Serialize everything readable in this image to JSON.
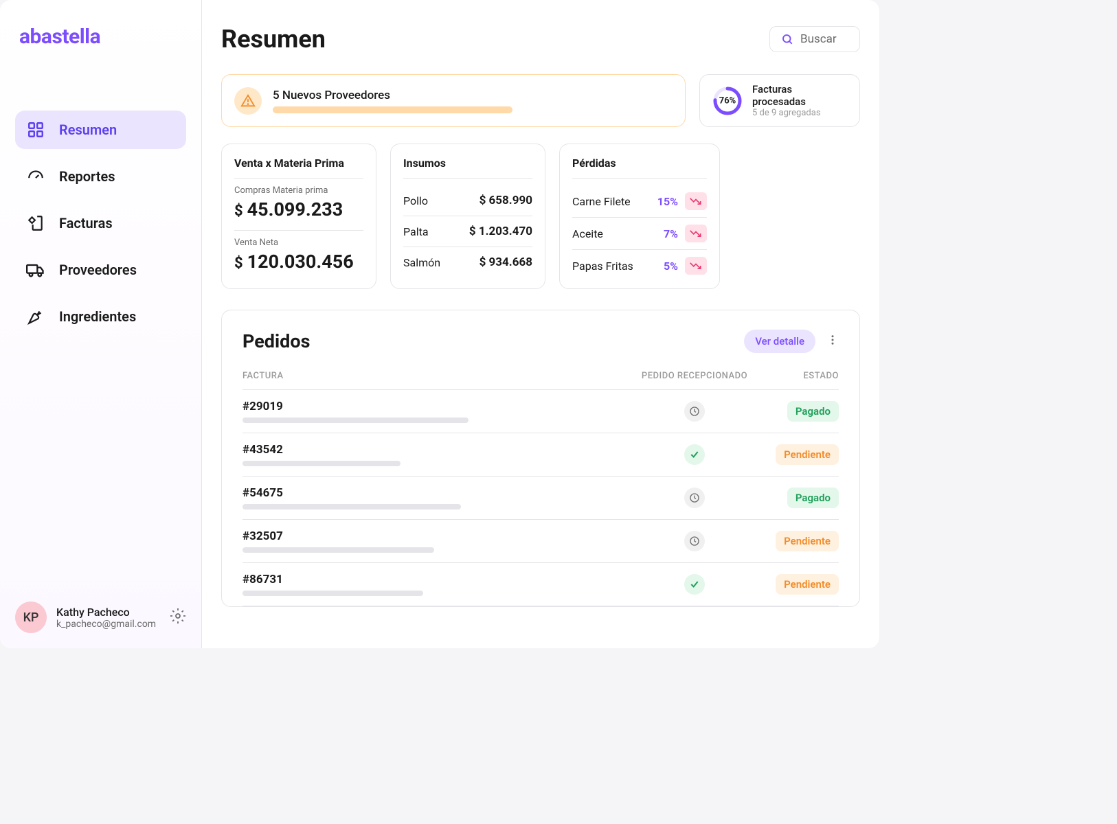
{
  "brand": "abastella",
  "sidebar": {
    "items": [
      {
        "label": "Resumen",
        "active": true
      },
      {
        "label": "Reportes",
        "active": false
      },
      {
        "label": "Facturas",
        "active": false
      },
      {
        "label": "Proveedores",
        "active": false
      },
      {
        "label": "Ingredientes",
        "active": false
      }
    ]
  },
  "user": {
    "initials": "KP",
    "name": "Kathy Pacheco",
    "email": "k_pacheco@gmail.com"
  },
  "header": {
    "title": "Resumen",
    "search_label": "Buscar"
  },
  "alert": {
    "title": "5 Nuevos Proveedores"
  },
  "processed_invoices": {
    "percent": "76%",
    "title": "Facturas procesadas",
    "subtitle": "5 de 9 agregadas"
  },
  "kpi_primary": {
    "title": "Venta x Materia Prima",
    "purchases_label": "Compras Materia prima",
    "purchases_value": "45.099.233",
    "net_label": "Venta Neta",
    "net_value": "120.030.456"
  },
  "insumos": {
    "title": "Insumos",
    "items": [
      {
        "name": "Pollo",
        "value": "$ 658.990"
      },
      {
        "name": "Palta",
        "value": "$ 1.203.470"
      },
      {
        "name": "Salmón",
        "value": "$ 934.668"
      }
    ]
  },
  "losses": {
    "title": "Pérdidas",
    "items": [
      {
        "name": "Carne Filete",
        "percent": "15%"
      },
      {
        "name": "Aceite",
        "percent": "7%"
      },
      {
        "name": "Papas Fritas",
        "percent": "5%"
      }
    ]
  },
  "orders": {
    "title": "Pedidos",
    "detail_label": "Ver detalle",
    "columns": {
      "invoice": "FACTURA",
      "received": "PEDIDO RECEPCIONADO",
      "status": "ESTADO"
    },
    "rows": [
      {
        "id": "#29019",
        "bar_width": "60%",
        "received": "clock",
        "status": "Pagado",
        "status_class": "paid"
      },
      {
        "id": "#43542",
        "bar_width": "42%",
        "received": "check",
        "status": "Pendiente",
        "status_class": "pending"
      },
      {
        "id": "#54675",
        "bar_width": "58%",
        "received": "clock",
        "status": "Pagado",
        "status_class": "paid"
      },
      {
        "id": "#32507",
        "bar_width": "51%",
        "received": "clock",
        "status": "Pendiente",
        "status_class": "pending"
      },
      {
        "id": "#86731",
        "bar_width": "48%",
        "received": "check",
        "status": "Pendiente",
        "status_class": "pending"
      }
    ]
  }
}
